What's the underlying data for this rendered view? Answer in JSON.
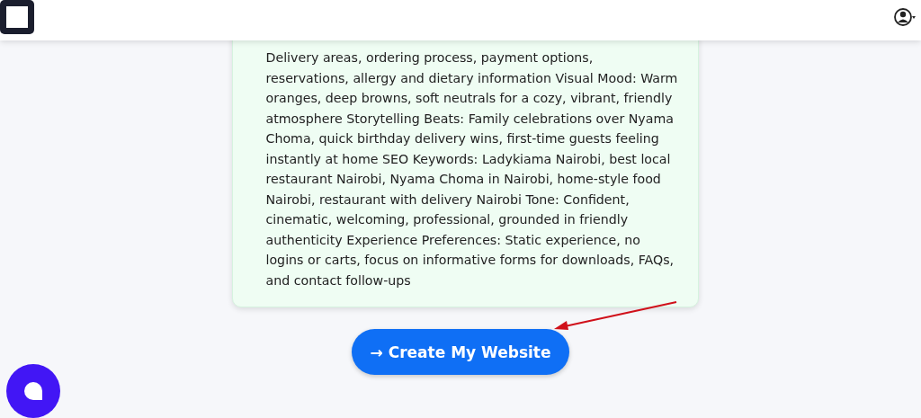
{
  "brief": {
    "text": "Delivery areas, ordering process, payment options, reservations, allergy and dietary information Visual Mood: Warm oranges, deep browns, soft neutrals for a cozy, vibrant, friendly atmosphere Storytelling Beats: Family celebrations over Nyama Choma, quick birthday delivery wins, first-time guests feeling instantly at home SEO Keywords: Ladykiama Nairobi, best local restaurant Nairobi, Nyama Choma in Nairobi, home-style food Nairobi, restaurant with delivery Nairobi Tone: Confident, cinematic, welcoming, professional, grounded in friendly authenticity Experience Preferences: Static experience, no logins or carts, focus on informative forms for downloads, FAQs, and contact follow-ups"
  },
  "cta_button": {
    "icon": "→",
    "label": "Create My Website"
  }
}
